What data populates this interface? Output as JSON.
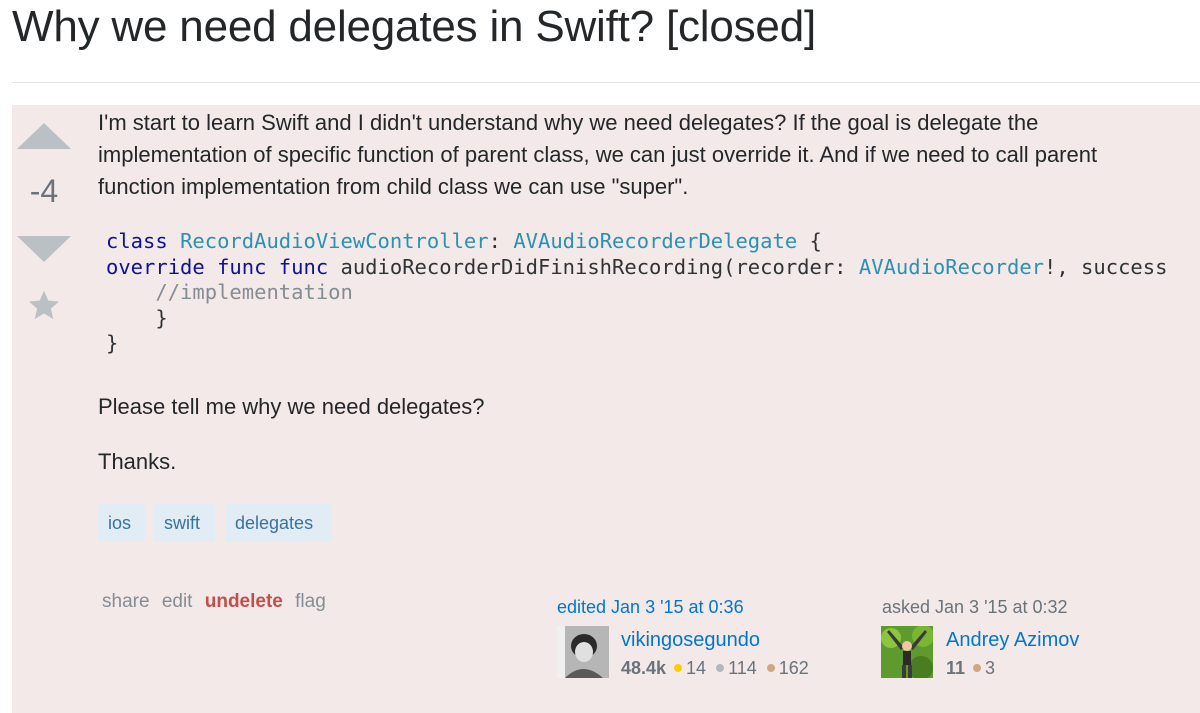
{
  "question": {
    "title": "Why we need delegates in Swift? [closed]",
    "vote_count": "-4",
    "body": {
      "paragraph_1": "I'm start to learn Swift and I didn't understand why we need delegates? If the goal is delegate the implementation of specific function of parent class, we can just override it. And if we need to call parent function implementation from child class we can use \"super\".",
      "paragraph_2": "Please tell me why we need delegates?",
      "paragraph_3": "Thanks."
    },
    "code": {
      "line1": {
        "kw": "class ",
        "name": "RecordAudioViewController",
        "sep": ": ",
        "proto": "AVAudioRecorderDelegate",
        "brace": " {"
      },
      "line2": {
        "kw": "override func func ",
        "fn": "audioRecorderDidFinishRecording(recorder: ",
        "type": "AVAudioRecorder",
        "rest": "!, success"
      },
      "line3": "    //implementation",
      "line4": "    }",
      "line5": "}"
    },
    "tags": [
      "ios",
      "swift",
      "delegates"
    ],
    "menu": {
      "share": "share",
      "edit": "edit",
      "undelete": "undelete",
      "flag": "flag"
    },
    "editor": {
      "action": "edited Jan 3 '15 at 0:36",
      "name": "vikingosegundo",
      "reputation": "48.4k",
      "gold": "14",
      "silver": "114",
      "bronze": "162"
    },
    "asker": {
      "action": "asked Jan 3 '15 at 0:32",
      "name": "Andrey Azimov",
      "reputation": "11",
      "bronze": "3"
    }
  },
  "icons": {
    "upvote": "arrow-up-icon",
    "downvote": "arrow-down-icon",
    "favorite": "star-icon"
  },
  "colors": {
    "deleted_background": "#f4e9e9",
    "link": "#0077cc",
    "undelete": "#c0504d",
    "tag_background": "#e1ecf4",
    "tag_text": "#39739d",
    "gold_badge": "#ffcc01",
    "silver_badge": "#b4b8bc",
    "bronze_badge": "#d1a684"
  }
}
